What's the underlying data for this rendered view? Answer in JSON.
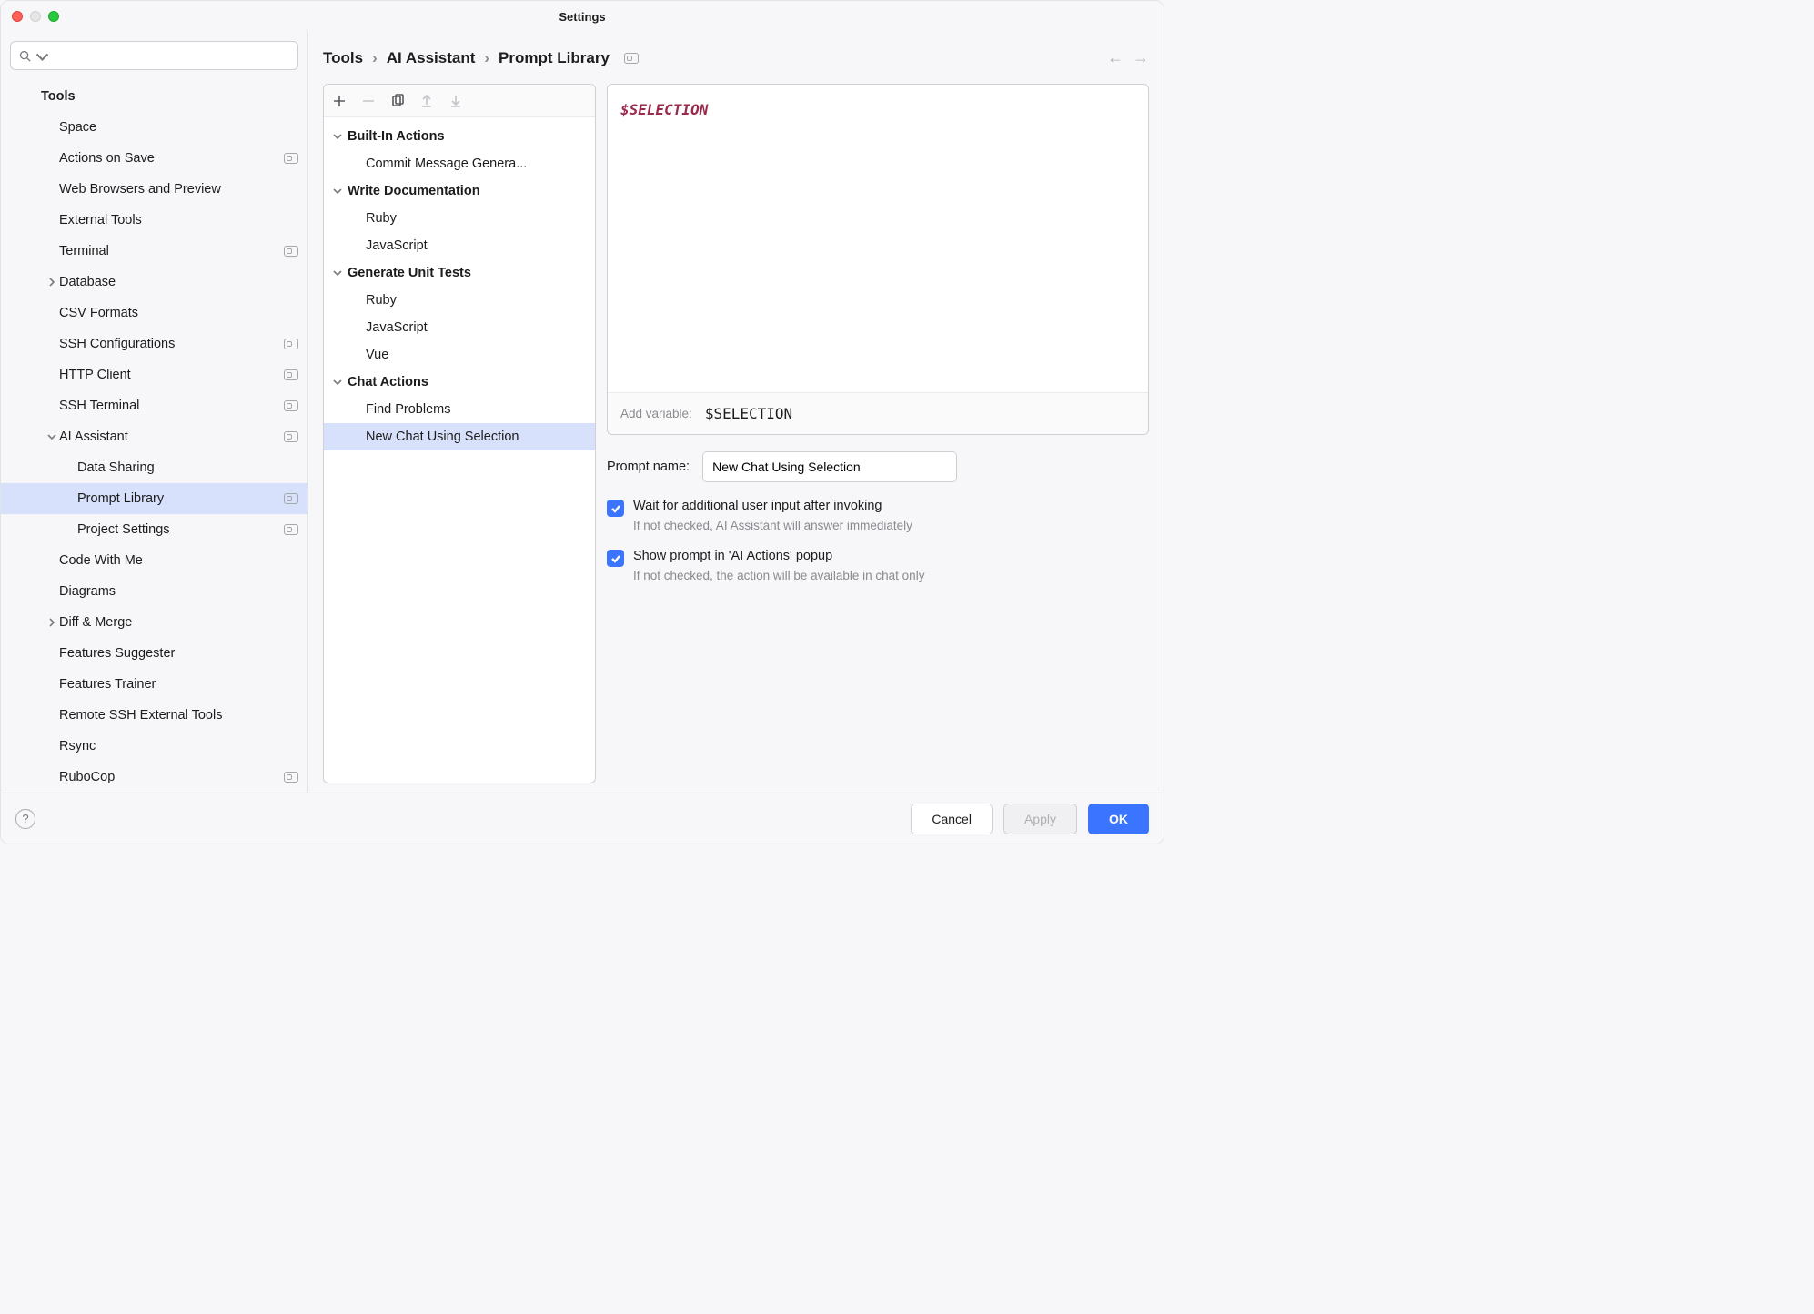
{
  "window": {
    "title": "Settings"
  },
  "search": {
    "placeholder": ""
  },
  "sidebar": {
    "section_label": "Tools",
    "items": [
      {
        "label": "Space",
        "indent": 1
      },
      {
        "label": "Actions on Save",
        "indent": 1,
        "badge": true
      },
      {
        "label": "Web Browsers and Preview",
        "indent": 1
      },
      {
        "label": "External Tools",
        "indent": 1
      },
      {
        "label": "Terminal",
        "indent": 1,
        "badge": true
      },
      {
        "label": "Database",
        "indent": 1,
        "expandable": true
      },
      {
        "label": "CSV Formats",
        "indent": 1
      },
      {
        "label": "SSH Configurations",
        "indent": 1,
        "badge": true
      },
      {
        "label": "HTTP Client",
        "indent": 1,
        "badge": true
      },
      {
        "label": "SSH Terminal",
        "indent": 1,
        "badge": true
      },
      {
        "label": "AI Assistant",
        "indent": 1,
        "expandable": true,
        "expanded": true,
        "badge": true
      },
      {
        "label": "Data Sharing",
        "indent": 2
      },
      {
        "label": "Prompt Library",
        "indent": 2,
        "badge": true,
        "selected": true
      },
      {
        "label": "Project Settings",
        "indent": 2,
        "badge": true
      },
      {
        "label": "Code With Me",
        "indent": 1
      },
      {
        "label": "Diagrams",
        "indent": 1
      },
      {
        "label": "Diff & Merge",
        "indent": 1,
        "expandable": true
      },
      {
        "label": "Features Suggester",
        "indent": 1
      },
      {
        "label": "Features Trainer",
        "indent": 1
      },
      {
        "label": "Remote SSH External Tools",
        "indent": 1
      },
      {
        "label": "Rsync",
        "indent": 1
      },
      {
        "label": "RuboCop",
        "indent": 1,
        "badge": true
      }
    ]
  },
  "breadcrumbs": [
    "Tools",
    "AI Assistant",
    "Prompt Library"
  ],
  "prompt_tree": [
    {
      "group": "Built-In Actions",
      "items": [
        "Commit Message Genera..."
      ]
    },
    {
      "group": "Write Documentation",
      "items": [
        "Ruby",
        "JavaScript"
      ]
    },
    {
      "group": "Generate Unit Tests",
      "items": [
        "Ruby",
        "JavaScript",
        "Vue"
      ]
    },
    {
      "group": "Chat Actions",
      "items": [
        "Find Problems",
        "New Chat Using Selection"
      ]
    }
  ],
  "selected_prompt_group_index": 3,
  "selected_prompt_item_index": 1,
  "editor": {
    "content": "$SELECTION",
    "add_variable_label": "Add variable:",
    "variable_button": "$SELECTION"
  },
  "form": {
    "prompt_name_label": "Prompt name:",
    "prompt_name_value": "New Chat Using Selection",
    "chk1_label": "Wait for additional user input after invoking",
    "chk1_hint": "If not checked, AI Assistant will answer immediately",
    "chk1_checked": true,
    "chk2_label": "Show prompt in 'AI Actions' popup",
    "chk2_hint": "If not checked, the action will be available in chat only",
    "chk2_checked": true
  },
  "footer": {
    "cancel": "Cancel",
    "apply": "Apply",
    "ok": "OK"
  }
}
